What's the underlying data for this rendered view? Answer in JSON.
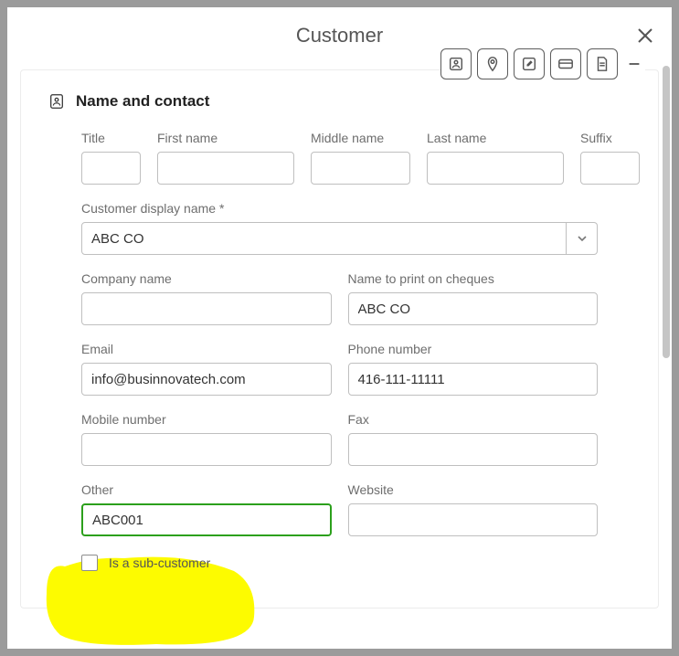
{
  "header": {
    "title": "Customer"
  },
  "section": {
    "title": "Name and contact"
  },
  "labels": {
    "title": "Title",
    "first_name": "First name",
    "middle_name": "Middle name",
    "last_name": "Last name",
    "suffix": "Suffix",
    "display_name": "Customer display name *",
    "company_name": "Company name",
    "name_cheques": "Name to print on cheques",
    "email": "Email",
    "phone": "Phone number",
    "mobile": "Mobile number",
    "fax": "Fax",
    "other": "Other",
    "website": "Website",
    "sub_customer": "Is a sub-customer"
  },
  "values": {
    "title": "",
    "first_name": "",
    "middle_name": "",
    "last_name": "",
    "suffix": "",
    "display_name": "ABC CO",
    "company_name": "",
    "name_cheques": "ABC CO",
    "email": "info@businnovatech.com",
    "phone": "416-111-11111",
    "mobile": "",
    "fax": "",
    "other": "ABC001",
    "website": ""
  }
}
